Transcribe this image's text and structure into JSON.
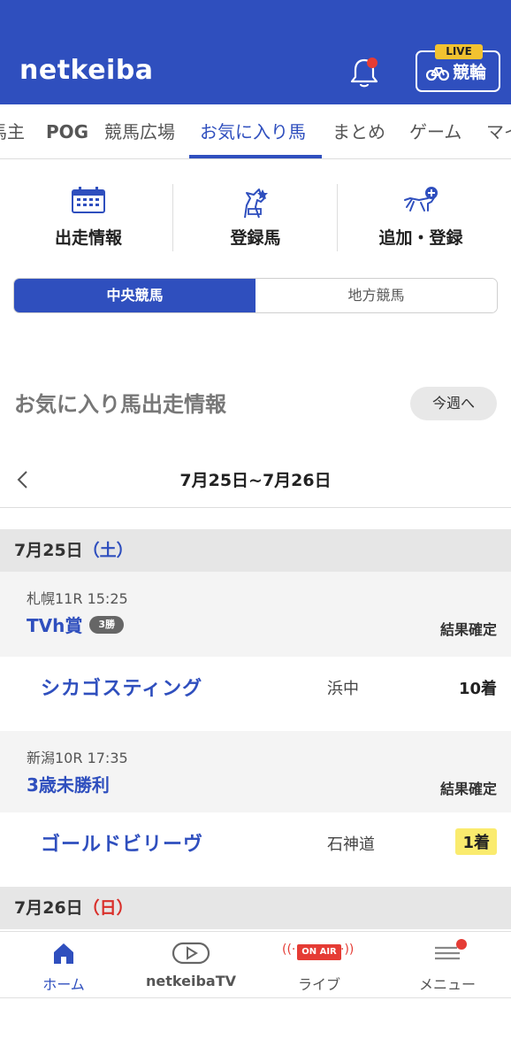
{
  "header": {
    "logo": "netkeiba",
    "live_badge": "LIVE",
    "live_label": "競輪"
  },
  "tabs": [
    {
      "label": "馬主"
    },
    {
      "label": "POG"
    },
    {
      "label": "競馬広場"
    },
    {
      "label": "お気に入り馬"
    },
    {
      "label": "まとめ"
    },
    {
      "label": "ゲーム"
    },
    {
      "label": "マイ"
    }
  ],
  "shortcuts": [
    {
      "label": "出走情報",
      "icon": "calendar-icon"
    },
    {
      "label": "登録馬",
      "icon": "horse-register-icon"
    },
    {
      "label": "追加・登録",
      "icon": "horse-add-icon"
    }
  ],
  "segment": {
    "central": "中央競馬",
    "local": "地方競馬"
  },
  "section": {
    "title": "お気に入り馬出走情報",
    "week_button": "今週へ"
  },
  "date_nav": {
    "range": "7月25日~7月26日"
  },
  "days": [
    {
      "date": "7月25日",
      "dow": "（土）"
    },
    {
      "date": "7月26日",
      "dow": "（日）"
    }
  ],
  "races": [
    {
      "meta": "札幌11R 15:25",
      "name": "TVh賞",
      "grade": "3勝",
      "status": "結果確定",
      "horse": "シカゴスティング",
      "jockey": "浜中",
      "place": "10着"
    },
    {
      "meta": "新潟10R 17:35",
      "name": "3歳未勝利",
      "grade": "",
      "status": "結果確定",
      "horse": "ゴールドビリーヴ",
      "jockey": "石神道",
      "place": "1着"
    }
  ],
  "bottom_nav": [
    {
      "label": "ホーム",
      "icon": "home-icon"
    },
    {
      "label": "netkeibaTV",
      "icon": "play-icon"
    },
    {
      "label": "ライブ",
      "icon": "onair-icon",
      "badge": "ON AIR"
    },
    {
      "label": "メニュー",
      "icon": "menu-icon"
    }
  ],
  "colors": {
    "brand": "#2f4fbe",
    "accent_red": "#e53c35",
    "live_yellow": "#f2c230",
    "win_highlight": "#faeb6e"
  }
}
